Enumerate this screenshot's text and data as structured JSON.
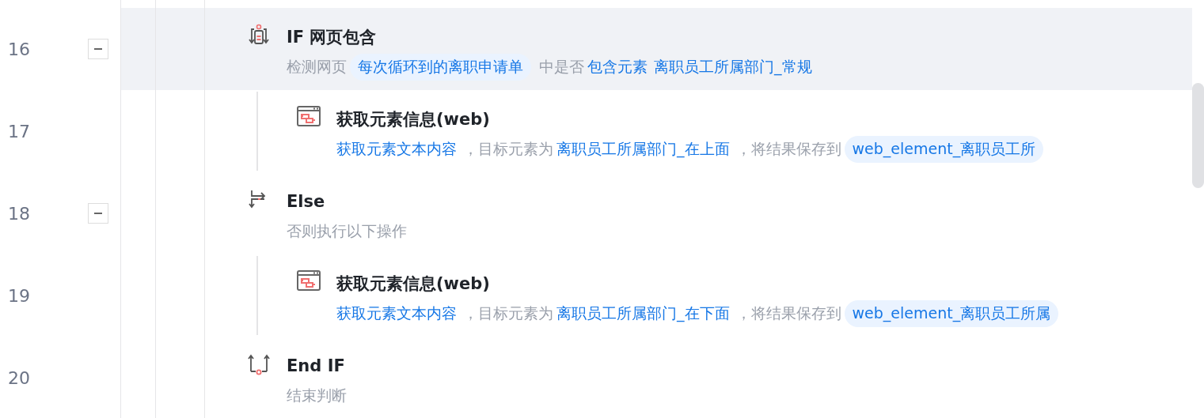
{
  "steps": [
    {
      "line": "16",
      "kind": "if",
      "selected": true,
      "expanded": true,
      "title": "IF 网页包含",
      "description": [
        {
          "kind": "text",
          "text": "检测网页"
        },
        {
          "kind": "chip",
          "text": "每次循环到的离职申请单"
        },
        {
          "kind": "text",
          "text": "中是否"
        },
        {
          "kind": "value",
          "text": "包含元素"
        },
        {
          "kind": "value",
          "text": "离职员工所属部门_常规"
        }
      ],
      "children": [
        {
          "line": "17",
          "kind": "action",
          "selected": false,
          "title": "获取元素信息(web)",
          "description": [
            {
              "kind": "value",
              "text": "获取元素文本内容"
            },
            {
              "kind": "text",
              "text": "，目标元素为"
            },
            {
              "kind": "value",
              "text": "离职员工所属部门_在上面"
            },
            {
              "kind": "text",
              "text": "，将结果保存到"
            },
            {
              "kind": "chip",
              "text": "web_element_离职员工所"
            }
          ]
        }
      ]
    },
    {
      "line": "18",
      "kind": "else",
      "selected": false,
      "expanded": true,
      "title": "Else",
      "description": [
        {
          "kind": "text",
          "text": "否则执行以下操作"
        }
      ],
      "children": [
        {
          "line": "19",
          "kind": "action",
          "selected": false,
          "title": "获取元素信息(web)",
          "description": [
            {
              "kind": "value",
              "text": "获取元素文本内容"
            },
            {
              "kind": "text",
              "text": "，目标元素为"
            },
            {
              "kind": "value",
              "text": "离职员工所属部门_在下面"
            },
            {
              "kind": "text",
              "text": "，将结果保存到"
            },
            {
              "kind": "chip",
              "text": "web_element_离职员工所属"
            }
          ]
        }
      ]
    },
    {
      "line": "20",
      "kind": "endif",
      "selected": false,
      "title": "End IF",
      "description": [
        {
          "kind": "text",
          "text": "结束判断"
        }
      ]
    }
  ]
}
